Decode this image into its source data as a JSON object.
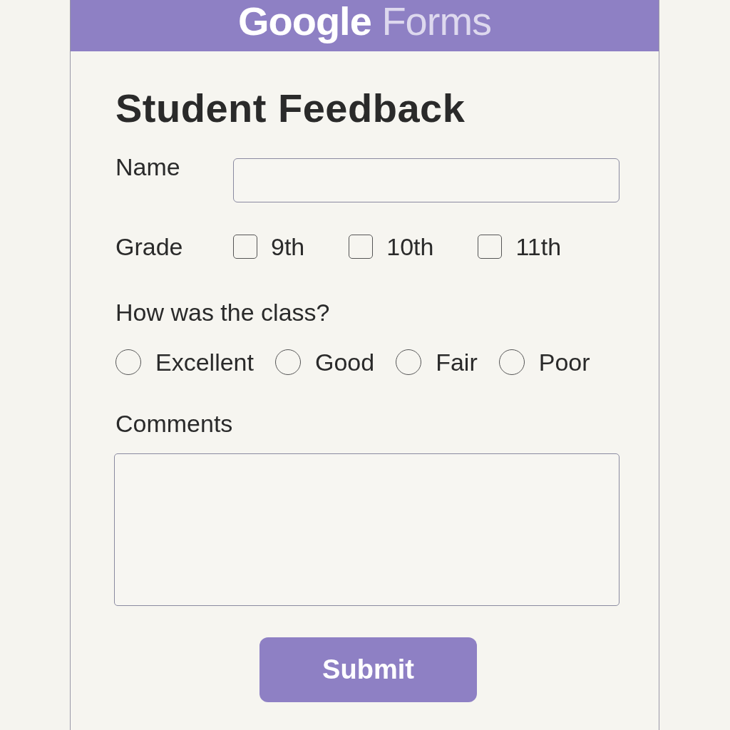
{
  "header": {
    "brand": "Google",
    "product": "Forms"
  },
  "title": "Student Feedback",
  "name_field": {
    "label": "Name"
  },
  "grade": {
    "label": "Grade",
    "options": [
      {
        "label": "9th",
        "checked": false
      },
      {
        "label": "10th",
        "checked": false
      },
      {
        "label": "11th",
        "checked": false
      }
    ]
  },
  "question": {
    "label": "How was the class?",
    "options": [
      {
        "label": "Excellent",
        "selected": false
      },
      {
        "label": "Good",
        "selected": false
      },
      {
        "label": "Fair",
        "selected": false
      },
      {
        "label": "Poor",
        "selected": false
      }
    ]
  },
  "comments": {
    "label": "Comments"
  },
  "submit": "Submit"
}
